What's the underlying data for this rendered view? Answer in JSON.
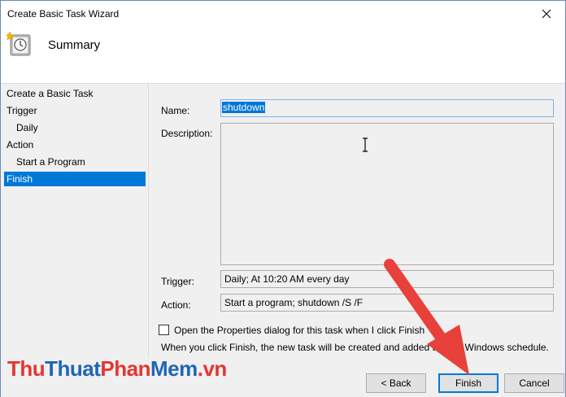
{
  "window": {
    "title": "Create Basic Task Wizard",
    "page_title": "Summary"
  },
  "nav": {
    "items": [
      {
        "label": "Create a Basic Task",
        "sub": false,
        "selected": false
      },
      {
        "label": "Trigger",
        "sub": false,
        "selected": false
      },
      {
        "label": "Daily",
        "sub": true,
        "selected": false
      },
      {
        "label": "Action",
        "sub": false,
        "selected": false
      },
      {
        "label": "Start a Program",
        "sub": true,
        "selected": false
      },
      {
        "label": "Finish",
        "sub": false,
        "selected": true
      }
    ]
  },
  "form": {
    "name_label": "Name:",
    "name_value": "shutdown",
    "description_label": "Description:",
    "description_value": "",
    "trigger_label": "Trigger:",
    "trigger_value": "Daily; At 10:20 AM every day",
    "action_label": "Action:",
    "action_value": "Start a program; shutdown /S /F",
    "open_properties_label": "Open the Properties dialog for this task when I click Finish",
    "open_properties_checked": false,
    "info_text": "When you click Finish, the new task will be created and added to your Windows schedule."
  },
  "buttons": {
    "back": "< Back",
    "finish": "Finish",
    "cancel": "Cancel"
  },
  "watermark": {
    "part1": "Thu",
    "part2": "Thuat",
    "part3": "Phan",
    "part4": "Mem",
    "part5": ".vn"
  },
  "colors": {
    "selection": "#0078d7",
    "arrow": "#e8403a",
    "watermark_red": "#e43632",
    "watermark_blue": "#1f66b5"
  }
}
